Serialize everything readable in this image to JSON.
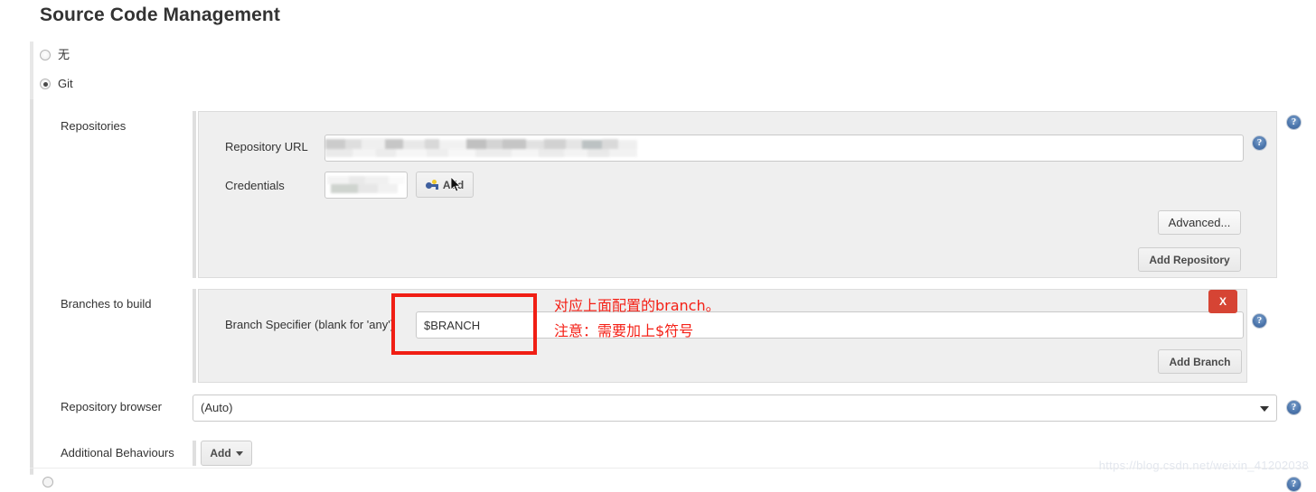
{
  "page": {
    "title": "Source Code Management",
    "watermark": "https://blog.csdn.net/weixin_41202038"
  },
  "scm_options": [
    {
      "label": "无",
      "selected": false
    },
    {
      "label": "Git",
      "selected": true
    }
  ],
  "repositories": {
    "section_label": "Repositories",
    "repository_url": {
      "label": "Repository URL",
      "value": "",
      "redacted": true
    },
    "credentials": {
      "label": "Credentials",
      "value": "",
      "redacted": true
    },
    "add_credentials_button": "Add",
    "advanced_button": "Advanced...",
    "add_repository_button": "Add Repository"
  },
  "branches": {
    "section_label": "Branches to build",
    "branch_specifier": {
      "label": "Branch Specifier (blank for 'any')",
      "value": "$BRANCH"
    },
    "add_branch_button": "Add Branch",
    "delete_button": "X"
  },
  "repository_browser": {
    "label": "Repository browser",
    "value": "(Auto)"
  },
  "additional_behaviours": {
    "label": "Additional Behaviours",
    "add_button": "Add"
  },
  "annotations": {
    "line1": "对应上面配置的branch。",
    "line2": "注意：需要加上$符号",
    "color": "#f41f15"
  },
  "help_icon_label": "?"
}
